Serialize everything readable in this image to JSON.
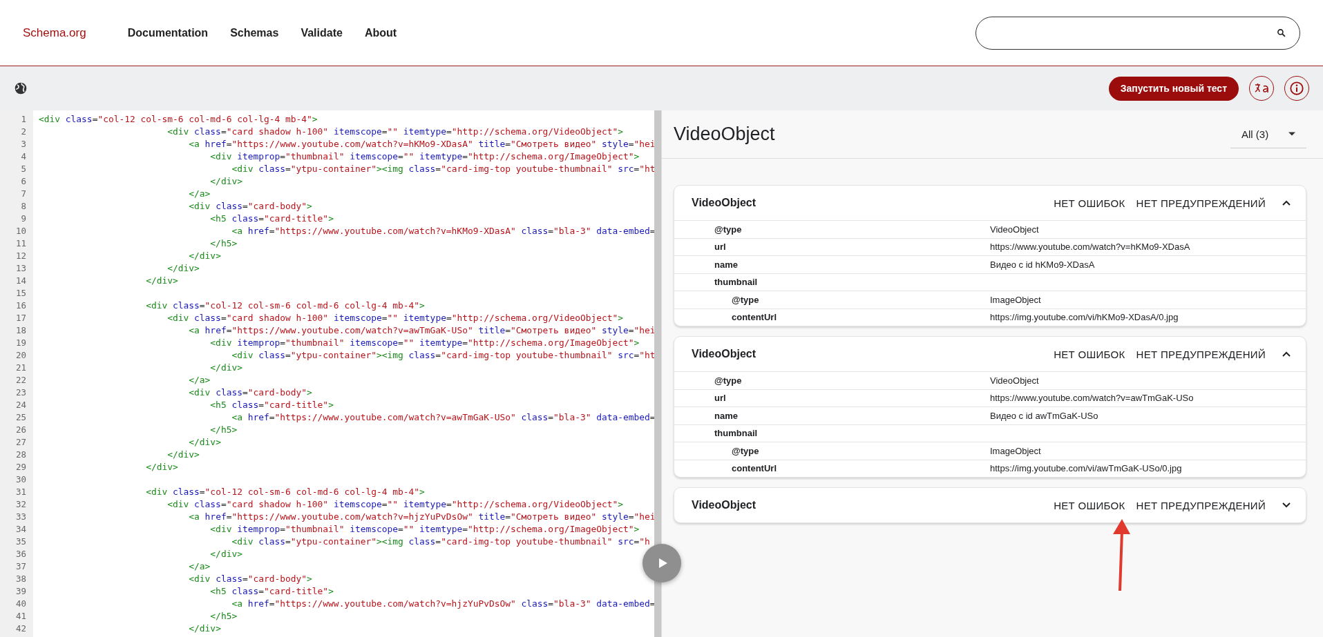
{
  "header": {
    "logo": "Schema.org",
    "nav": [
      "Documentation",
      "Schemas",
      "Validate",
      "About"
    ]
  },
  "toolbar": {
    "run_button": "Запустить новый тест"
  },
  "editor": {
    "lines": [
      {
        "number": "1",
        "text": "<div class=\"col-12 col-sm-6 col-md-6 col-lg-4 mb-4\">"
      },
      {
        "number": "2",
        "text": "                        <div class=\"card shadow h-100\" itemscope=\"\" itemtype=\"http://schema.org/VideoObject\">"
      },
      {
        "number": "3",
        "text": "                            <a href=\"https://www.youtube.com/watch?v=hKMo9-XDasA\" title=\"Смотреть видео\" style=\"hei"
      },
      {
        "number": "4",
        "text": "                                <div itemprop=\"thumbnail\" itemscope=\"\" itemtype=\"http://schema.org/ImageObject\">"
      },
      {
        "number": "5",
        "text": "                                    <div class=\"ytpu-container\"><img class=\"card-img-top youtube-thumbnail\" src=\"ht"
      },
      {
        "number": "6",
        "text": "                                </div>"
      },
      {
        "number": "7",
        "text": "                            </a>"
      },
      {
        "number": "8",
        "text": "                            <div class=\"card-body\">"
      },
      {
        "number": "9",
        "text": "                                <h5 class=\"card-title\">"
      },
      {
        "number": "10",
        "text": "                                    <a href=\"https://www.youtube.com/watch?v=hKMo9-XDasA\" class=\"bla-3\" data-embed="
      },
      {
        "number": "11",
        "text": "                                </h5>"
      },
      {
        "number": "12",
        "text": "                            </div>"
      },
      {
        "number": "13",
        "text": "                        </div>"
      },
      {
        "number": "14",
        "text": "                    </div>"
      },
      {
        "number": "15"
      },
      {
        "number": "16",
        "text": "                    <div class=\"col-12 col-sm-6 col-md-6 col-lg-4 mb-4\">"
      },
      {
        "number": "17",
        "text": "                        <div class=\"card shadow h-100\" itemscope=\"\" itemtype=\"http://schema.org/VideoObject\">"
      },
      {
        "number": "18",
        "text": "                            <a href=\"https://www.youtube.com/watch?v=awTmGaK-USo\" title=\"Смотреть видео\" style=\"hei"
      },
      {
        "number": "19",
        "text": "                                <div itemprop=\"thumbnail\" itemscope=\"\" itemtype=\"http://schema.org/ImageObject\">"
      },
      {
        "number": "20",
        "text": "                                    <div class=\"ytpu-container\"><img class=\"card-img-top youtube-thumbnail\" src=\"ht"
      },
      {
        "number": "21",
        "text": "                                </div>"
      },
      {
        "number": "22",
        "text": "                            </a>"
      },
      {
        "number": "23",
        "text": "                            <div class=\"card-body\">"
      },
      {
        "number": "24",
        "text": "                                <h5 class=\"card-title\">"
      },
      {
        "number": "25",
        "text": "                                    <a href=\"https://www.youtube.com/watch?v=awTmGaK-USo\" class=\"bla-3\" data-embed="
      },
      {
        "number": "26",
        "text": "                                </h5>"
      },
      {
        "number": "27",
        "text": "                            </div>"
      },
      {
        "number": "28",
        "text": "                        </div>"
      },
      {
        "number": "29",
        "text": "                    </div>"
      },
      {
        "number": "30"
      },
      {
        "number": "31",
        "text": "                    <div class=\"col-12 col-sm-6 col-md-6 col-lg-4 mb-4\">"
      },
      {
        "number": "32",
        "text": "                        <div class=\"card shadow h-100\" itemscope=\"\" itemtype=\"http://schema.org/VideoObject\">"
      },
      {
        "number": "33",
        "text": "                            <a href=\"https://www.youtube.com/watch?v=hjzYuPvDsOw\" title=\"Смотреть видео\" style=\"hei"
      },
      {
        "number": "34",
        "text": "                                <div itemprop=\"thumbnail\" itemscope=\"\" itemtype=\"http://schema.org/ImageObject\">"
      },
      {
        "number": "35",
        "text": "                                    <div class=\"ytpu-container\"><img class=\"card-img-top youtube-thumbnail\" src=\"h"
      },
      {
        "number": "36",
        "text": "                                </div>"
      },
      {
        "number": "37",
        "text": "                            </a>"
      },
      {
        "number": "38",
        "text": "                            <div class=\"card-body\">"
      },
      {
        "number": "39",
        "text": "                                <h5 class=\"card-title\">"
      },
      {
        "number": "40",
        "text": "                                    <a href=\"https://www.youtube.com/watch?v=hjzYuPvDsOw\" class=\"bla-3\" data-embed="
      },
      {
        "number": "41",
        "text": "                                </h5>"
      },
      {
        "number": "42",
        "text": "                            </div>"
      }
    ]
  },
  "results": {
    "title": "VideoObject",
    "filter": "All (3)",
    "items": [
      {
        "title": "VideoObject",
        "errors": "НЕТ ОШИБОК",
        "warnings": "НЕТ ПРЕДУПРЕЖДЕНИЙ",
        "expanded": true,
        "properties": [
          {
            "name": "@type",
            "value": "VideoObject"
          },
          {
            "name": "url",
            "value": "https://www.youtube.com/watch?v=hKMo9-XDasA"
          },
          {
            "name": "name",
            "value": "Видео с id hKMo9-XDasA"
          },
          {
            "name": "thumbnail",
            "children": [
              {
                "name": "@type",
                "value": "ImageObject"
              },
              {
                "name": "contentUrl",
                "value": "https://img.youtube.com/vi/hKMo9-XDasA/0.jpg"
              }
            ]
          }
        ]
      },
      {
        "title": "VideoObject",
        "errors": "НЕТ ОШИБОК",
        "warnings": "НЕТ ПРЕДУПРЕЖДЕНИЙ",
        "expanded": true,
        "properties": [
          {
            "name": "@type",
            "value": "VideoObject"
          },
          {
            "name": "url",
            "value": "https://www.youtube.com/watch?v=awTmGaK-USo"
          },
          {
            "name": "name",
            "value": "Видео с id awTmGaK-USo"
          },
          {
            "name": "thumbnail",
            "children": [
              {
                "name": "@type",
                "value": "ImageObject"
              },
              {
                "name": "contentUrl",
                "value": "https://img.youtube.com/vi/awTmGaK-USo/0.jpg"
              }
            ]
          }
        ]
      },
      {
        "title": "VideoObject",
        "errors": "НЕТ ОШИБОК",
        "warnings": "НЕТ ПРЕДУПРЕЖДЕНИЙ",
        "expanded": false
      }
    ]
  }
}
